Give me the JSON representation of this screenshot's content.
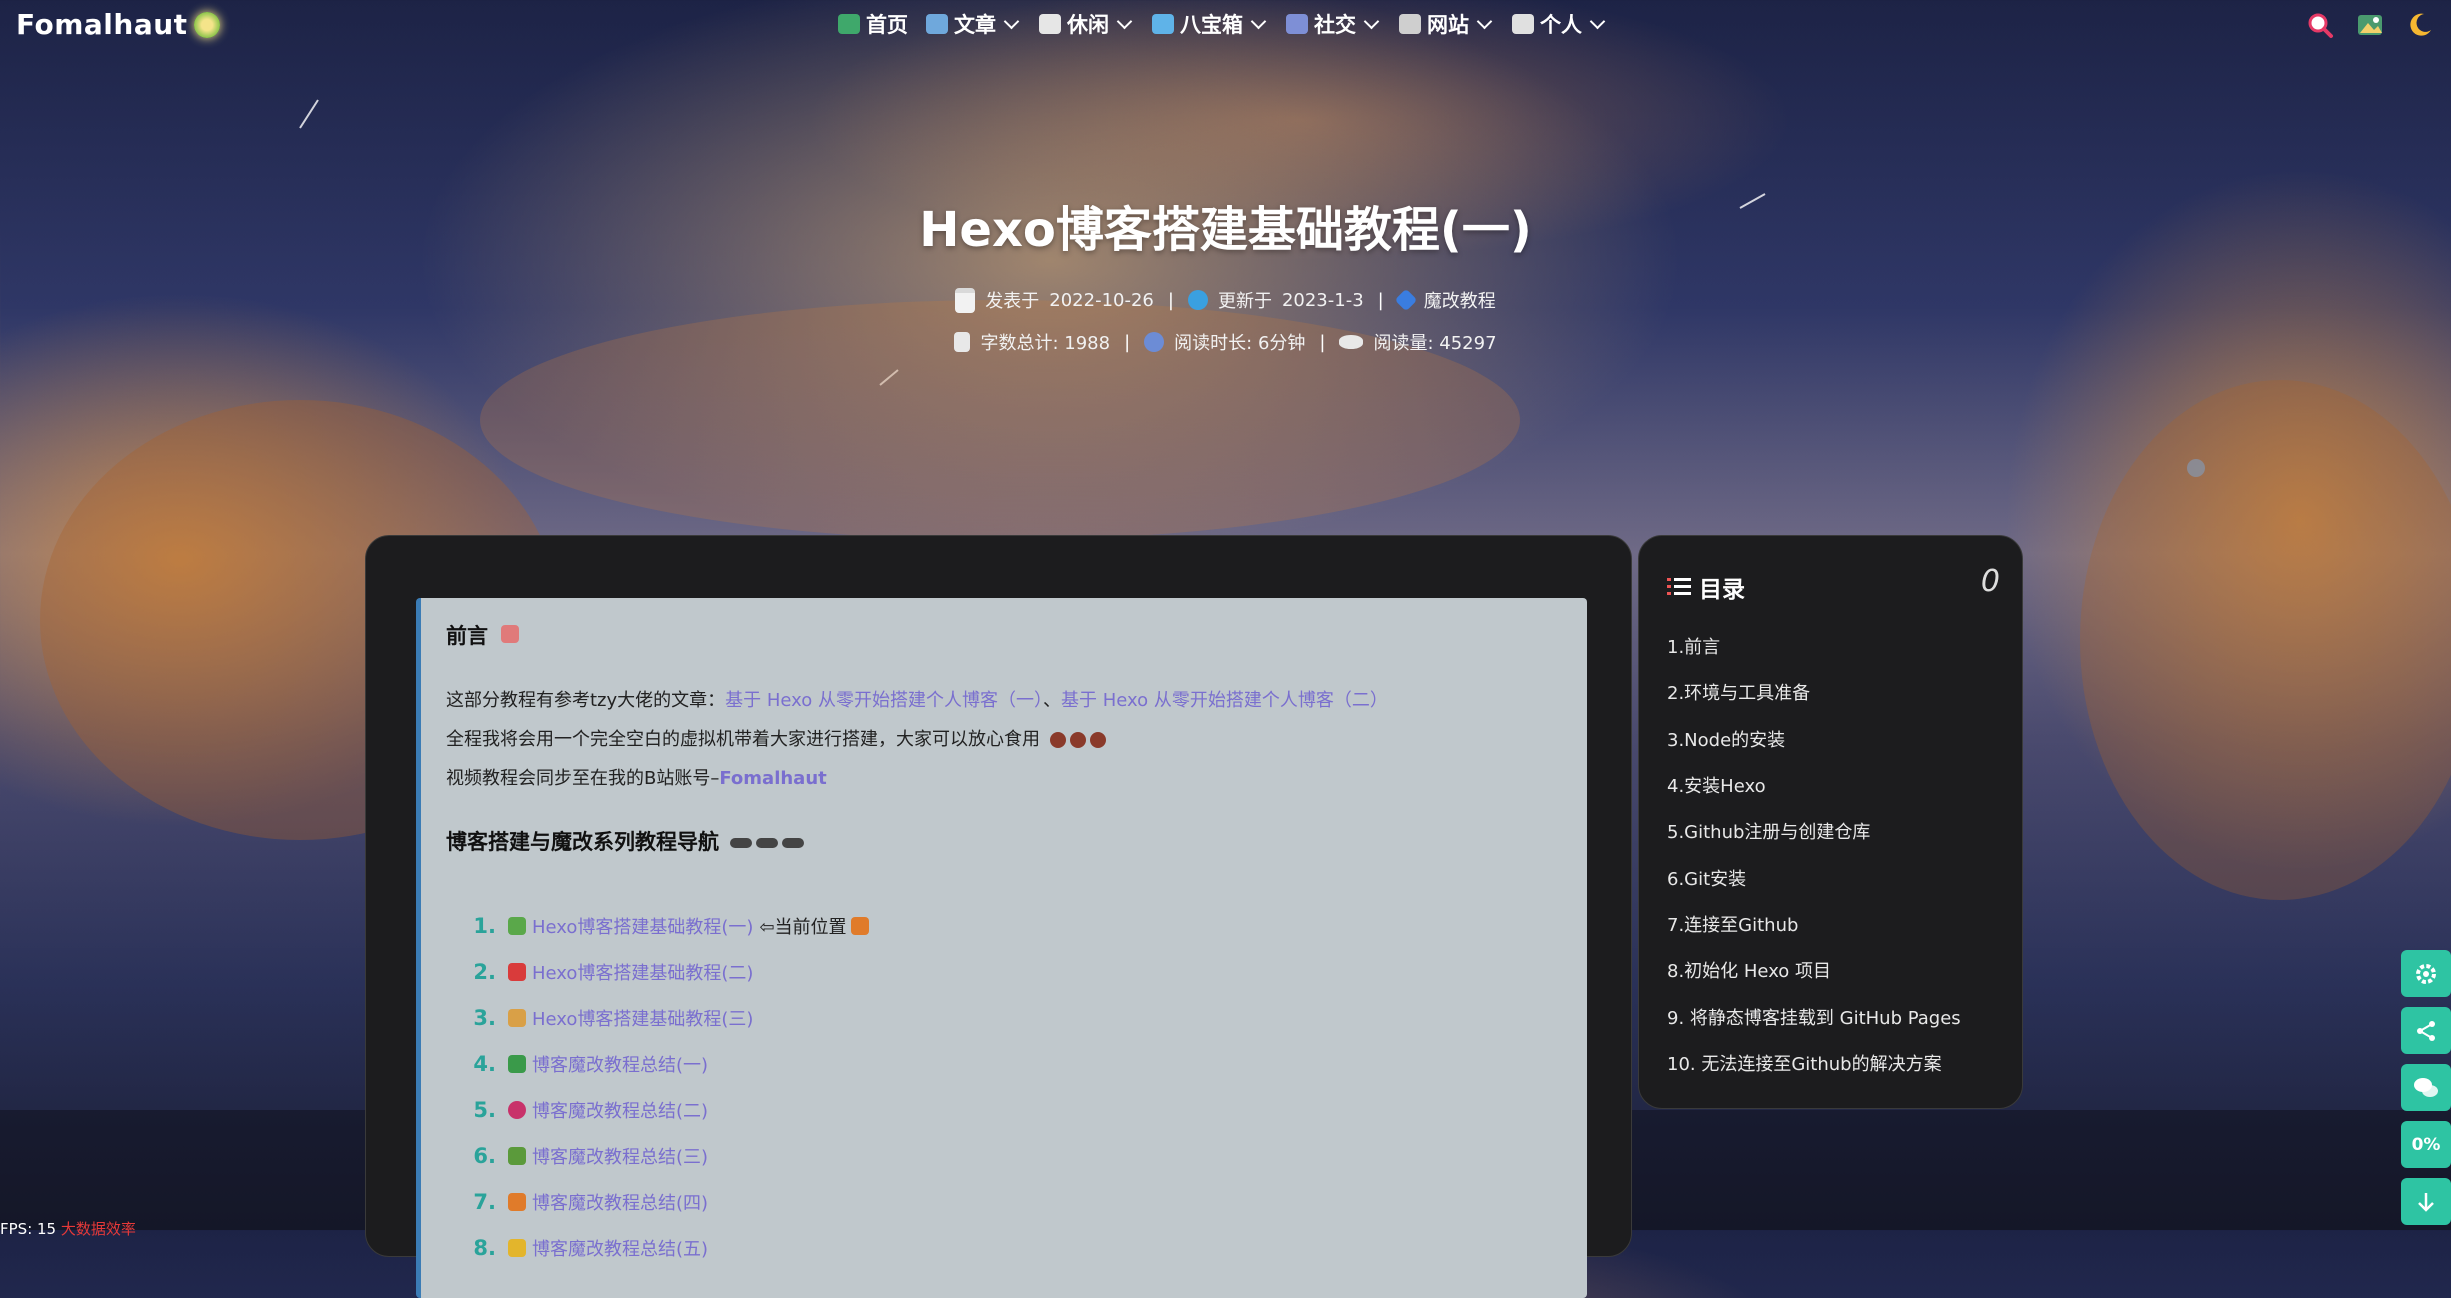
{
  "brand": {
    "name": "Fomalhaut"
  },
  "nav": {
    "items": [
      {
        "label": "首页",
        "icon": "home-icon",
        "dropdown": false,
        "color": "#3fa86b"
      },
      {
        "label": "文章",
        "icon": "book-icon",
        "dropdown": true,
        "color": "#6fa8dc"
      },
      {
        "label": "休闲",
        "icon": "game-icon",
        "dropdown": true,
        "color": "#e6e6e6"
      },
      {
        "label": "八宝箱",
        "icon": "box-icon",
        "dropdown": true,
        "color": "#5fb3e8"
      },
      {
        "label": "社交",
        "icon": "chat-icon",
        "dropdown": true,
        "color": "#7e8fd6"
      },
      {
        "label": "网站",
        "icon": "keyboard-icon",
        "dropdown": true,
        "color": "#cfcfcf"
      },
      {
        "label": "个人",
        "icon": "phone-icon",
        "dropdown": true,
        "color": "#e0e0e0"
      }
    ],
    "right": [
      "search-icon",
      "wallpaper-icon",
      "moon-icon"
    ]
  },
  "post": {
    "title": "Hexo博客搭建基础教程(一)",
    "published_label": "发表于",
    "published_date": "2022-10-26",
    "updated_label": "更新于",
    "updated_date": "2023-1-3",
    "category": "魔改教程",
    "word_count": "字数总计: 1988",
    "read_time": "阅读时长: 6分钟",
    "read_count": "阅读量: 45297"
  },
  "content": {
    "heading1": "前言",
    "line1_prefix": "这部分教程有参考tzy大佬的文章：",
    "line1_link1": "基于 Hexo 从零开始搭建个人博客（一）",
    "line1_sep": "、",
    "line1_link2": "基于 Hexo 从零开始搭建个人博客（二）",
    "line2": "全程我将会用一个完全空白的虚拟机带着大家进行搭建，大家可以放心食用",
    "line3_prefix": "视频教程会同步至在我的B站账号–",
    "line3_link": "Fomalhaut",
    "heading2": "博客搭建与魔改系列教程导航",
    "series": [
      {
        "num": "1.",
        "title": "Hexo博客搭建基础教程(一)",
        "suffix": "⇦当前位置",
        "color": "#5aa84a"
      },
      {
        "num": "2.",
        "title": "Hexo博客搭建基础教程(二)",
        "suffix": "",
        "color": "#d93b3b"
      },
      {
        "num": "3.",
        "title": "Hexo博客搭建基础教程(三)",
        "suffix": "",
        "color": "#d9a047"
      },
      {
        "num": "4.",
        "title": "博客魔改教程总结(一)",
        "suffix": "",
        "color": "#3a9a4a"
      },
      {
        "num": "5.",
        "title": "博客魔改教程总结(二)",
        "suffix": "",
        "color": "#c8326a"
      },
      {
        "num": "6.",
        "title": "博客魔改教程总结(三)",
        "suffix": "",
        "color": "#5b9a3b"
      },
      {
        "num": "7.",
        "title": "博客魔改教程总结(四)",
        "suffix": "",
        "color": "#e07b2a"
      },
      {
        "num": "8.",
        "title": "博客魔改教程总结(五)",
        "suffix": "",
        "color": "#e3b52c"
      }
    ]
  },
  "toc": {
    "title": "目录",
    "count": "0",
    "items": [
      "1.前言",
      "2.环境与工具准备",
      "3.Node的安装",
      "4.安装Hexo",
      "5.Github注册与创建仓库",
      "6.Git安装",
      "7.连接至Github",
      "8.初始化 Hexo 项目",
      "9. 将静态博客挂载到 GitHub Pages",
      "10. 无法连接至Github的解决方案"
    ]
  },
  "float": {
    "percent": "0%"
  },
  "status": {
    "prefix": "FPS: 15",
    "red": "大数据效率"
  },
  "colors": {
    "accent": "#2ec4a3",
    "link": "#7a6fcf",
    "number": "#2aa39a"
  }
}
